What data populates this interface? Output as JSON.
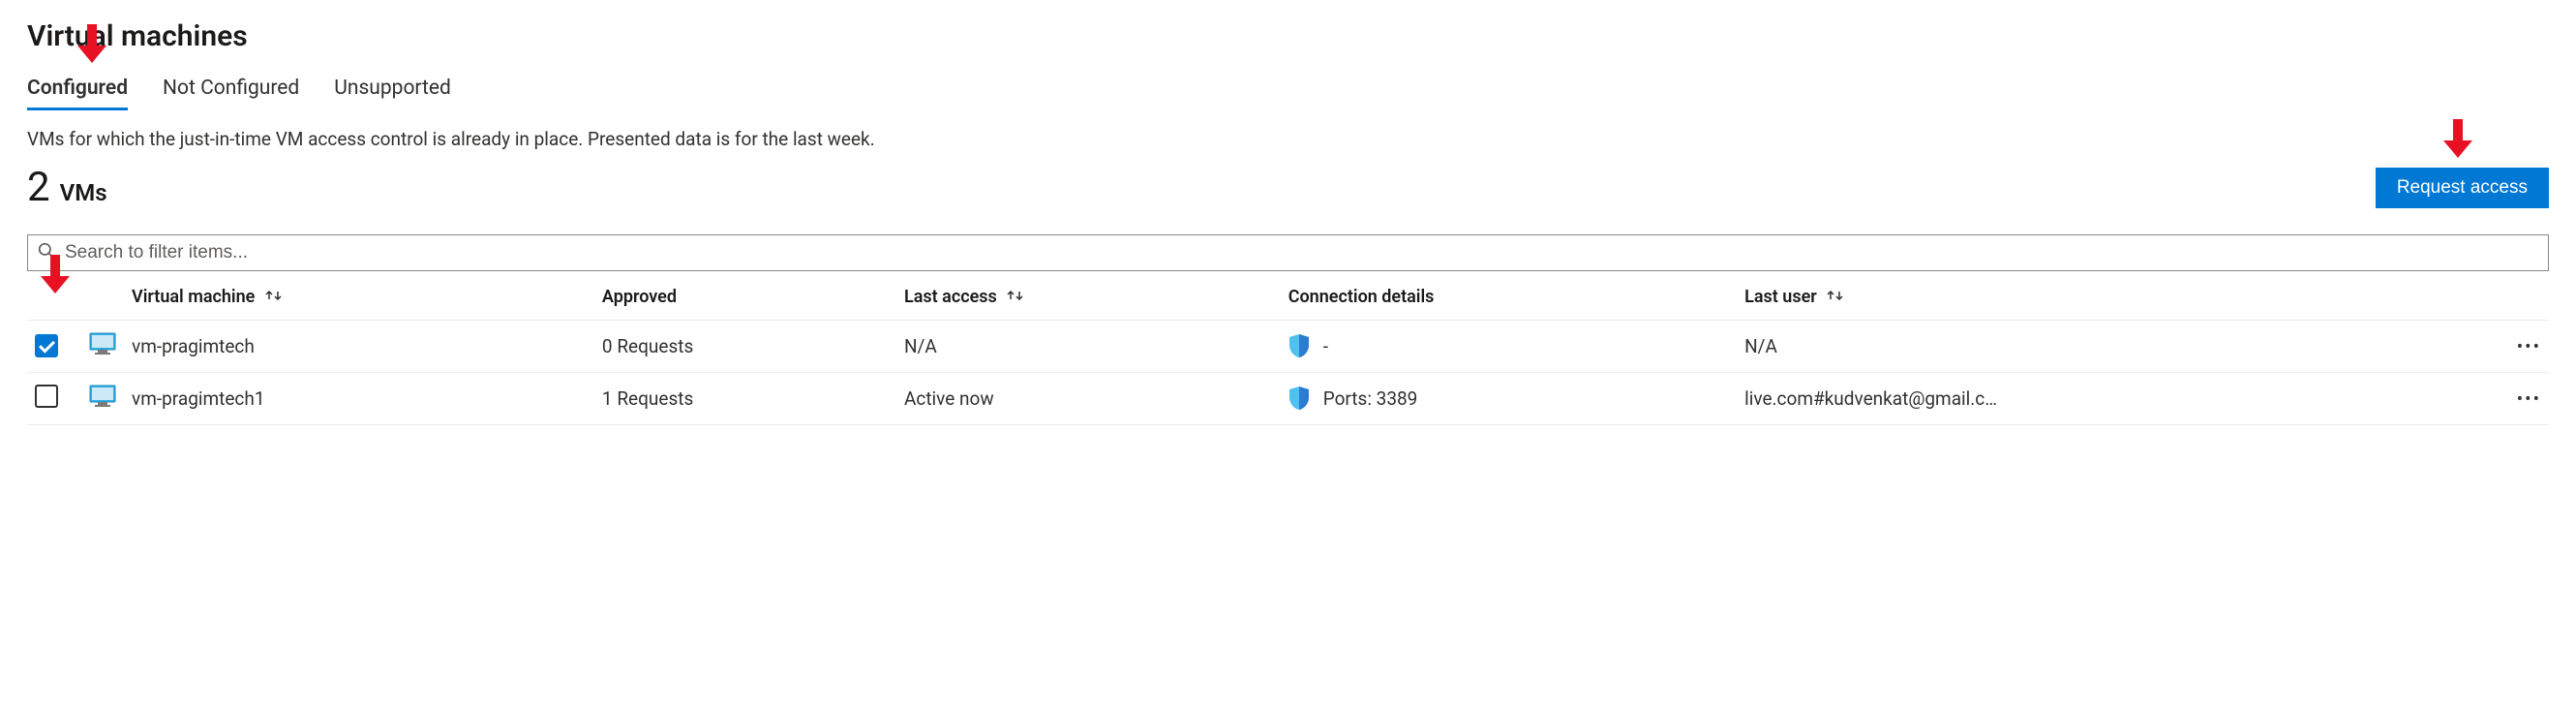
{
  "title": "Virtual machines",
  "tabs": [
    {
      "label": "Configured",
      "active": true
    },
    {
      "label": "Not Configured",
      "active": false
    },
    {
      "label": "Unsupported",
      "active": false
    }
  ],
  "description": "VMs for which the just-in-time VM access control is already in place. Presented data is for the last week.",
  "count": {
    "number": "2",
    "label": "VMs"
  },
  "actions": {
    "request_access": "Request access"
  },
  "search": {
    "placeholder": "Search to filter items..."
  },
  "columns": {
    "vm": "Virtual machine",
    "approved": "Approved",
    "last_access": "Last access",
    "connection": "Connection details",
    "last_user": "Last user"
  },
  "rows": [
    {
      "checked": true,
      "name": "vm-pragimtech",
      "approved": "0 Requests",
      "last_access": "N/A",
      "connection": "-",
      "last_user": "N/A"
    },
    {
      "checked": false,
      "name": "vm-pragimtech1",
      "approved": "1 Requests",
      "last_access": "Active now",
      "connection": "Ports: 3389",
      "last_user": "live.com#kudvenkat@gmail.c…"
    }
  ],
  "icons": {
    "more": "•••"
  }
}
